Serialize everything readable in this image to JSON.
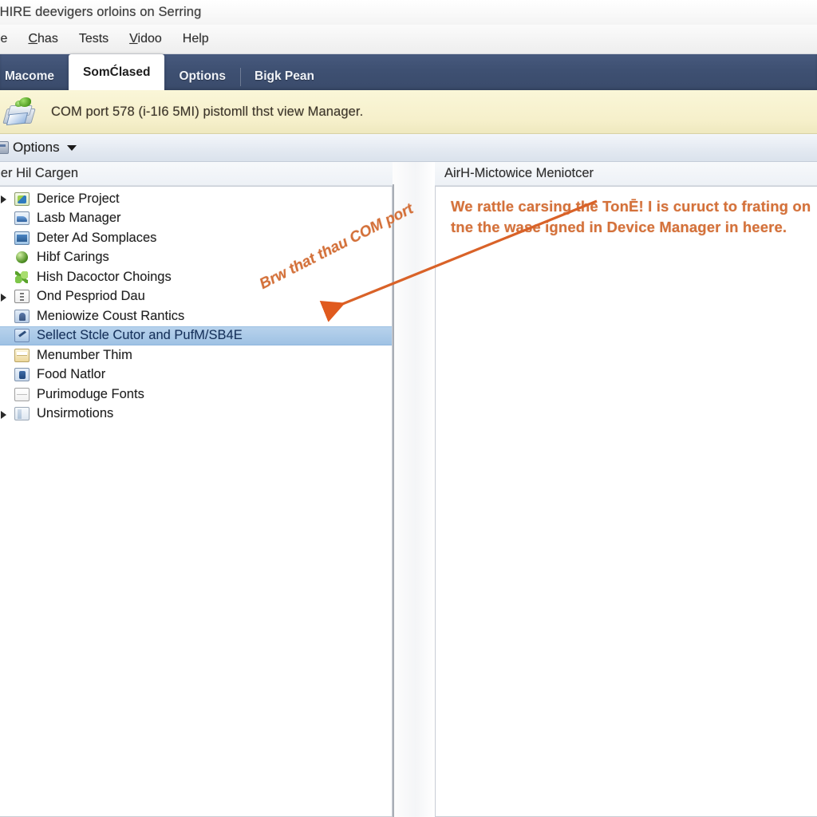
{
  "window": {
    "title": "´HIRE deevigers orloins on Serring"
  },
  "menubar": {
    "items": [
      {
        "label": "le",
        "accel": ""
      },
      {
        "label": "Chas",
        "accel": "C"
      },
      {
        "label": "Tests",
        "accel": ""
      },
      {
        "label": "Vidoo",
        "accel": "V"
      },
      {
        "label": "Help",
        "accel": ""
      }
    ]
  },
  "tabs": [
    {
      "label": "Macome",
      "active": false
    },
    {
      "label": "SomĆlased",
      "active": true
    },
    {
      "label": "Options",
      "active": false
    },
    {
      "label": "Bigk Pean",
      "active": false
    }
  ],
  "infobar": {
    "icon": "printer-with-leaf-icon",
    "message": "COM port 578 (i-1I6 5MI) pistomll thst view Manager."
  },
  "toolbar": {
    "icon": "options-icon",
    "label": "Options",
    "caret": "chevron-down-icon"
  },
  "left_pane": {
    "header": "iger Hil Cargen",
    "items": [
      {
        "label": "Derice Project",
        "icon": "puzzle-icon",
        "expander": true,
        "selected": false
      },
      {
        "label": "Lasb Manager",
        "icon": "disk-icon",
        "expander": false,
        "selected": false
      },
      {
        "label": "Deter Ad Somplaces",
        "icon": "monitor-icon",
        "expander": false,
        "selected": false
      },
      {
        "label": "Hibf Carings",
        "icon": "sphere-icon",
        "expander": false,
        "selected": false
      },
      {
        "label": "Hish Dacoctor Choings",
        "icon": "arrows-icon",
        "expander": false,
        "selected": false
      },
      {
        "label": "Ond Pespriod Dau",
        "icon": "ports-icon",
        "expander": true,
        "selected": false
      },
      {
        "label": "Meniowize Coust Rantics",
        "icon": "person-icon",
        "expander": false,
        "selected": false
      },
      {
        "label": "Sellect Stcle Cutor and PufM/SB4E",
        "icon": "pen-icon",
        "expander": false,
        "selected": true
      },
      {
        "label": "Menumber Thim",
        "icon": "folder-icon",
        "expander": false,
        "selected": false
      },
      {
        "label": "Food Natlor",
        "icon": "plug-icon",
        "expander": false,
        "selected": false
      },
      {
        "label": "Purimoduge Fonts",
        "icon": "blank-icon",
        "expander": false,
        "selected": false
      },
      {
        "label": "Unsirmotions",
        "icon": "folder2-icon",
        "expander": true,
        "selected": false
      }
    ]
  },
  "right_pane": {
    "header": "AirH-Mictowice Meniotcer",
    "note": "We rattle carsing the TonĒ! I is curuct to frating on tne the wase igned in Device Manager in heere."
  },
  "annotation": {
    "text": "Brw that thau COM port",
    "arrow": "arrow-pointing-left-down"
  },
  "colors": {
    "tab_strip": "#3E5072",
    "infobar_bg": "#F6F0CB",
    "selection": "#A8C8E8",
    "annotation_orange": "#D4713A"
  }
}
